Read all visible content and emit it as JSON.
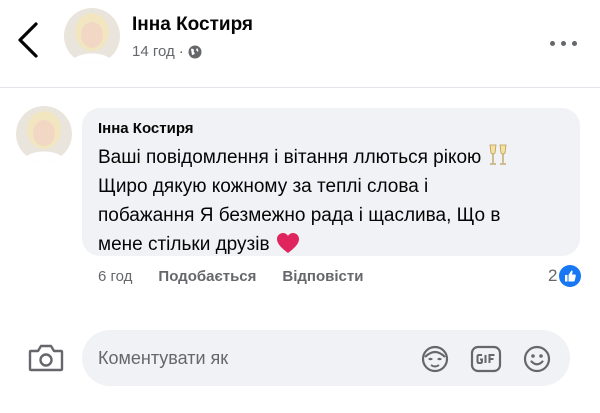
{
  "post": {
    "author": "Інна Костиря",
    "time": "14 год"
  },
  "comment": {
    "author": "Інна Костиря",
    "lines": [
      "Ваші повідомлення і вітання ллються рікою",
      "Щиро дякую кожному за теплі слова і",
      "побажання Я безмежно рада і щаслива, Що в",
      "мене стільки друзів"
    ],
    "time": "6 год",
    "like_label": "Подобається",
    "reply_label": "Відповісти",
    "reaction_count": "2"
  },
  "composer": {
    "placeholder": "Коментувати як"
  },
  "colors": {
    "accent": "#1877f2",
    "bubble": "#f0f2f5",
    "secondary_text": "#65676b",
    "heart": "#e0245e"
  },
  "icons": [
    "chevron-left-icon",
    "globe-icon",
    "more-icon",
    "champagne-icon",
    "heart-icon",
    "like-icon",
    "camera-icon",
    "avatar-sticker-icon",
    "gif-icon",
    "emoji-icon"
  ]
}
